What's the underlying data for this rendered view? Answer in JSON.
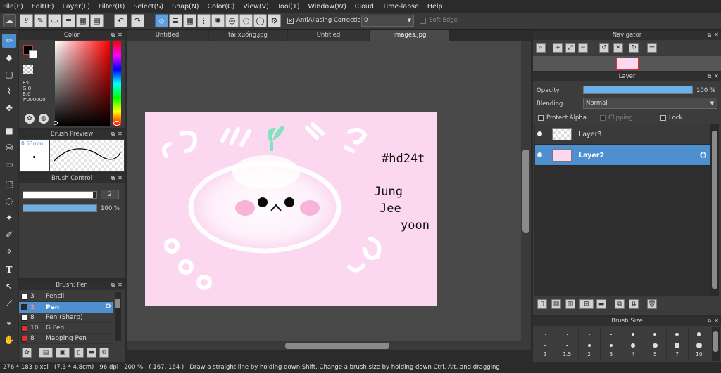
{
  "menu": [
    "File(F)",
    "Edit(E)",
    "Layer(L)",
    "Filter(R)",
    "Select(S)",
    "Snap(N)",
    "Color(C)",
    "View(V)",
    "Tool(T)",
    "Window(W)",
    "Cloud",
    "Time-lapse",
    "Help"
  ],
  "toolbar": {
    "antialiasing_label": "AntiAliasing",
    "correction_label": "Correction",
    "correction_value": "0",
    "soft_edge_label": "Soft Edge"
  },
  "tabs": [
    "Untitled",
    "tải xuống.jpg",
    "Untitled",
    "images.jpg"
  ],
  "color_panel": {
    "title": "Color",
    "r": "R:0",
    "g": "G:0",
    "b": "B:0",
    "hex": "#000000",
    "main_color": "#000000"
  },
  "brush_preview": {
    "title": "Brush Preview",
    "size": "0.53mm"
  },
  "brush_control": {
    "title": "Brush Control",
    "size": "2",
    "opacity": "100 %",
    "size_level": 0.95,
    "opacity_level": 1.0
  },
  "brush_list": {
    "title": "Brush: Pen",
    "items": [
      {
        "num": "3",
        "name": "Pencil",
        "color": "#ffffff",
        "selected": false
      },
      {
        "num": "2",
        "name": "Pen",
        "color": "#2a2a2a",
        "selected": true
      },
      {
        "num": "8",
        "name": "Pen (Sharp)",
        "color": "#ffffff",
        "selected": false
      },
      {
        "num": "10",
        "name": "G Pen",
        "color": "#e53030",
        "selected": false
      },
      {
        "num": "8",
        "name": "Mapping Pen",
        "color": "#e53030",
        "selected": false
      }
    ]
  },
  "navigator": {
    "title": "Navigator"
  },
  "layer_panel": {
    "title": "Layer",
    "opacity_label": "Opacity",
    "opacity_value": "100 %",
    "blending_label": "Blending",
    "blending_value": "Normal",
    "protect_alpha": "Protect Alpha",
    "clipping": "Clipping",
    "lock": "Lock",
    "layers": [
      {
        "name": "Layer3",
        "selected": false
      },
      {
        "name": "Layer2",
        "selected": true
      }
    ]
  },
  "brush_size": {
    "title": "Brush Size",
    "sizes": [
      "1",
      "1.5",
      "2",
      "3",
      "4",
      "5",
      "7",
      "10"
    ]
  },
  "artwork": {
    "text1": "#hd24t",
    "text2a": "Jung",
    "text2b": "Jee",
    "text2c": "yoon"
  },
  "status": {
    "pixel_size": "276 * 183 pixel",
    "cm_size": "(7.3 * 4.8cm)",
    "dpi": "96 dpi",
    "zoom": "200 %",
    "coords": "( 167, 164 )",
    "hint": "Draw a straight line by holding down Shift, Change a brush size by holding down Ctrl, Alt, and dragging"
  }
}
